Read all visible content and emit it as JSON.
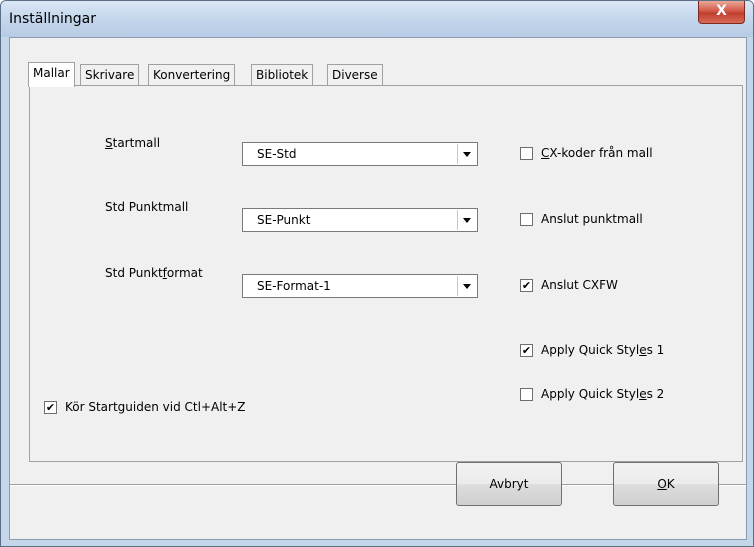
{
  "window": {
    "title": "Inställningar",
    "close_label": "X"
  },
  "tabs": [
    {
      "label": "Mallar",
      "active": true
    },
    {
      "label": "Skrivare",
      "active": false
    },
    {
      "label": "Konvertering",
      "active": false
    },
    {
      "label": "Bibliotek",
      "active": false
    },
    {
      "label": "Diverse",
      "active": false
    }
  ],
  "fields": {
    "startmall": {
      "label_pre": "",
      "label_u": "S",
      "label_post": "tartmall",
      "value": "SE-Std"
    },
    "punktmall": {
      "label": "Std Punktmall",
      "value": "SE-Punkt"
    },
    "punktformat": {
      "label_pre": "Std Punkt",
      "label_u": "f",
      "label_post": "ormat",
      "value": "SE-Format-1"
    }
  },
  "checkboxes": {
    "cx_koder": {
      "pre": "",
      "u": "C",
      "post": "X-koder från mall",
      "checked": false
    },
    "anslut_punktmall": {
      "pre": "Anslut punktmall",
      "u": "",
      "post": "",
      "checked": false
    },
    "anslut_cxfw": {
      "pre": "Anslut CXFW",
      "u": "",
      "post": "",
      "checked": true
    },
    "quick_styles_1": {
      "pre": "Apply Quick Styl",
      "u": "e",
      "post": "s 1",
      "checked": true
    },
    "quick_styles_2": {
      "pre": "Apply Quick Styl",
      "u": "e",
      "post": "s 2",
      "checked": false
    },
    "startguiden": {
      "pre": "Kör Startguiden vid Ctl+Alt+Z",
      "u": "",
      "post": "",
      "checked": true
    }
  },
  "buttons": {
    "cancel": {
      "pre": "Avbryt",
      "u": "",
      "post": ""
    },
    "ok": {
      "pre": "",
      "u": "O",
      "post": "K"
    }
  },
  "check_mark": "✔"
}
